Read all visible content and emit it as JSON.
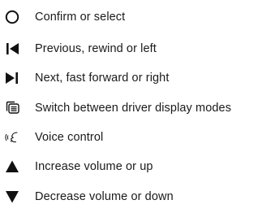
{
  "legend": {
    "items": [
      {
        "icon": "circle-outline-icon",
        "label": "Confirm or select"
      },
      {
        "icon": "previous-bar-triangle-left-icon",
        "label": "Previous, rewind or left"
      },
      {
        "icon": "next-triangle-bar-right-icon",
        "label": "Next, fast forward or right"
      },
      {
        "icon": "display-modes-icon",
        "label": "Switch between driver display modes"
      },
      {
        "icon": "voice-control-icon",
        "label": "Voice control"
      },
      {
        "icon": "triangle-up-icon",
        "label": "Increase volume or up"
      },
      {
        "icon": "triangle-down-icon",
        "label": "Decrease volume or down"
      }
    ]
  },
  "colors": {
    "text": "#1a1a1a",
    "icon": "#111111",
    "background": "#ffffff"
  }
}
